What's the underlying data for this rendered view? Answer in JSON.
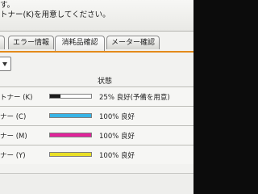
{
  "message": {
    "line1": "す。",
    "line2": "トナー(K)を用意してください。"
  },
  "tabs": [
    {
      "label": "",
      "active": false
    },
    {
      "label": "エラー情報",
      "active": false
    },
    {
      "label": "消耗品確認",
      "active": true
    },
    {
      "label": "メーター確認",
      "active": false
    }
  ],
  "list": {
    "status_header": "状態",
    "items": [
      {
        "name": "トナー (K)",
        "level_percent": 25,
        "color": "#1b1b1b",
        "status": "25% 良好(予備を用意)"
      },
      {
        "name": "ナー (C)",
        "level_percent": 100,
        "color": "#38b4e6",
        "status": "100% 良好"
      },
      {
        "name": "ナー (M)",
        "level_percent": 100,
        "color": "#e0239a",
        "status": "100% 良好"
      },
      {
        "name": "ナー (Y)",
        "level_percent": 100,
        "color": "#e9df27",
        "status": "100% 良好"
      }
    ]
  },
  "colors": {
    "accent": "#e38b1b"
  }
}
